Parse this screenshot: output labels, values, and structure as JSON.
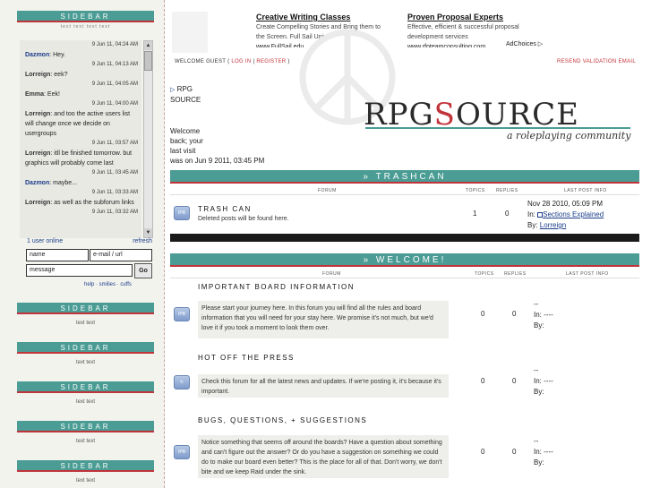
{
  "sidebar_main": {
    "title": "SIDEBAR",
    "subtitle": "text text text text"
  },
  "chat": {
    "messages": [
      {
        "time": "9 Jun 11, 04:24 AM",
        "user": "Dazmon",
        "text": ": Hey."
      },
      {
        "time": "9 Jun 11, 04:13 AM",
        "user": "Lorreign",
        "text": ": eek?"
      },
      {
        "time": "9 Jun 11, 04:05 AM",
        "user": "Emma",
        "text": ": Eek!"
      },
      {
        "time": "9 Jun 11, 04:00 AM",
        "user": "Lorreign",
        "text": ": and too the active users list will change once we decide on usergroups"
      },
      {
        "time": "9 Jun 11, 03:57 AM",
        "user": "Lorreign",
        "text": ": itll be finished tomorrow. but graphics will probably come last"
      },
      {
        "time": "9 Jun 11, 03:45 AM",
        "user": "Dazmon",
        "text": ": maybe..."
      },
      {
        "time": "9 Jun 11, 03:33 AM",
        "user": "Lorreign",
        "text": ": as well as the subforum links"
      },
      {
        "time": "9 Jun 11, 03:32 AM",
        "user": "",
        "text": ""
      }
    ],
    "online_count": "1 user online",
    "refresh_label": "refresh",
    "name_placeholder": "name",
    "email_placeholder": "e-mail / url",
    "message_placeholder": "message",
    "go_label": "Go",
    "extras": "help · smilies · cuffs"
  },
  "sidebar_blocks": [
    {
      "title": "SIDEBAR",
      "text": "text text"
    },
    {
      "title": "SIDEBAR",
      "text": "text text"
    },
    {
      "title": "SIDEBAR",
      "text": "text text"
    },
    {
      "title": "SIDEBAR",
      "text": "text text"
    },
    {
      "title": "SIDEBAR",
      "text": "text text"
    }
  ],
  "ads": [
    {
      "title": "Creative Writing Classes",
      "line1": "Create Compelling Stories and Bring them to",
      "line2": "the Screen. Full Sail Univ.",
      "url": "www.FullSail.edu"
    },
    {
      "title": "Proven Proposal Experts",
      "line1": "Effective, efficient & successful proposal",
      "line2": "development services",
      "url": "www.rfpteamconsulting.com"
    }
  ],
  "adchoices": "AdChoices ▷",
  "header": {
    "welcome": "WELCOME GUEST (",
    "login": "LOG IN",
    "sep": "|",
    "register": "REGISTER",
    "close": ")",
    "resend": "RESEND VALIDATION EMAIL"
  },
  "rpg_side": {
    "arrow": "▷",
    "line1": "RPG",
    "line2": "SOURCE"
  },
  "visit": {
    "l1": "Welcome",
    "l2": "back; your",
    "l3": "last visit",
    "l4": "was on Jun 9 2011, 03:45 PM"
  },
  "logo": {
    "pre": "RPG",
    "s": "S",
    "post": "OURCE",
    "tagline": "a roleplaying community"
  },
  "categories": [
    {
      "title": "» TRASHCAN",
      "cols": {
        "forum": "FORUM",
        "topics": "TOPICS",
        "replies": "REPLIES",
        "last": "LAST POST INFO"
      },
      "forums": [
        {
          "icon": "IPB",
          "name": "TRASH CAN",
          "desc": "Deleted posts will be found here.",
          "topics": "1",
          "replies": "0",
          "last_date": "Nov 28 2010, 05:09 PM",
          "last_in_label": "In:",
          "last_in": "Sections Explained",
          "last_by_label": "By:",
          "last_by": "Lorreign"
        }
      ]
    },
    {
      "title": "» WELCOME!",
      "cols": {
        "forum": "FORUM",
        "topics": "TOPICS",
        "replies": "REPLIES",
        "last": "LAST POST INFO"
      },
      "forums": [
        {
          "icon": "IPB",
          "name": "IMPORTANT BOARD INFORMATION",
          "desc": "Please start your journey here. In this forum you will find all the rules and board information that you will need for your stay here. We promise it's not much, but we'd love it if you took a moment to look them over.",
          "topics": "0",
          "replies": "0",
          "l1": "--",
          "l2": "In: ----",
          "l3": "By:"
        },
        {
          "icon": "↻",
          "name": "HOT OFF THE PRESS",
          "desc": "Check this forum for all the latest news and updates. If we're posting it, it's because it's important.",
          "topics": "0",
          "replies": "0",
          "l1": "--",
          "l2": "In: ----",
          "l3": "By:"
        },
        {
          "icon": "IPB",
          "name": "BUGS, QUESTIONS, + SUGGESTIONS",
          "desc": "Notice something that seems off around the boards? Have a question about something and can't figure out the answer? Or do you have a suggestion on something we could do to make our board even better? This is the place for all of that. Don't worry, we don't bite and we keep Raid under the sink.",
          "topics": "0",
          "replies": "0",
          "l1": "--",
          "l2": "In: ----",
          "l3": "By:"
        }
      ]
    }
  ]
}
